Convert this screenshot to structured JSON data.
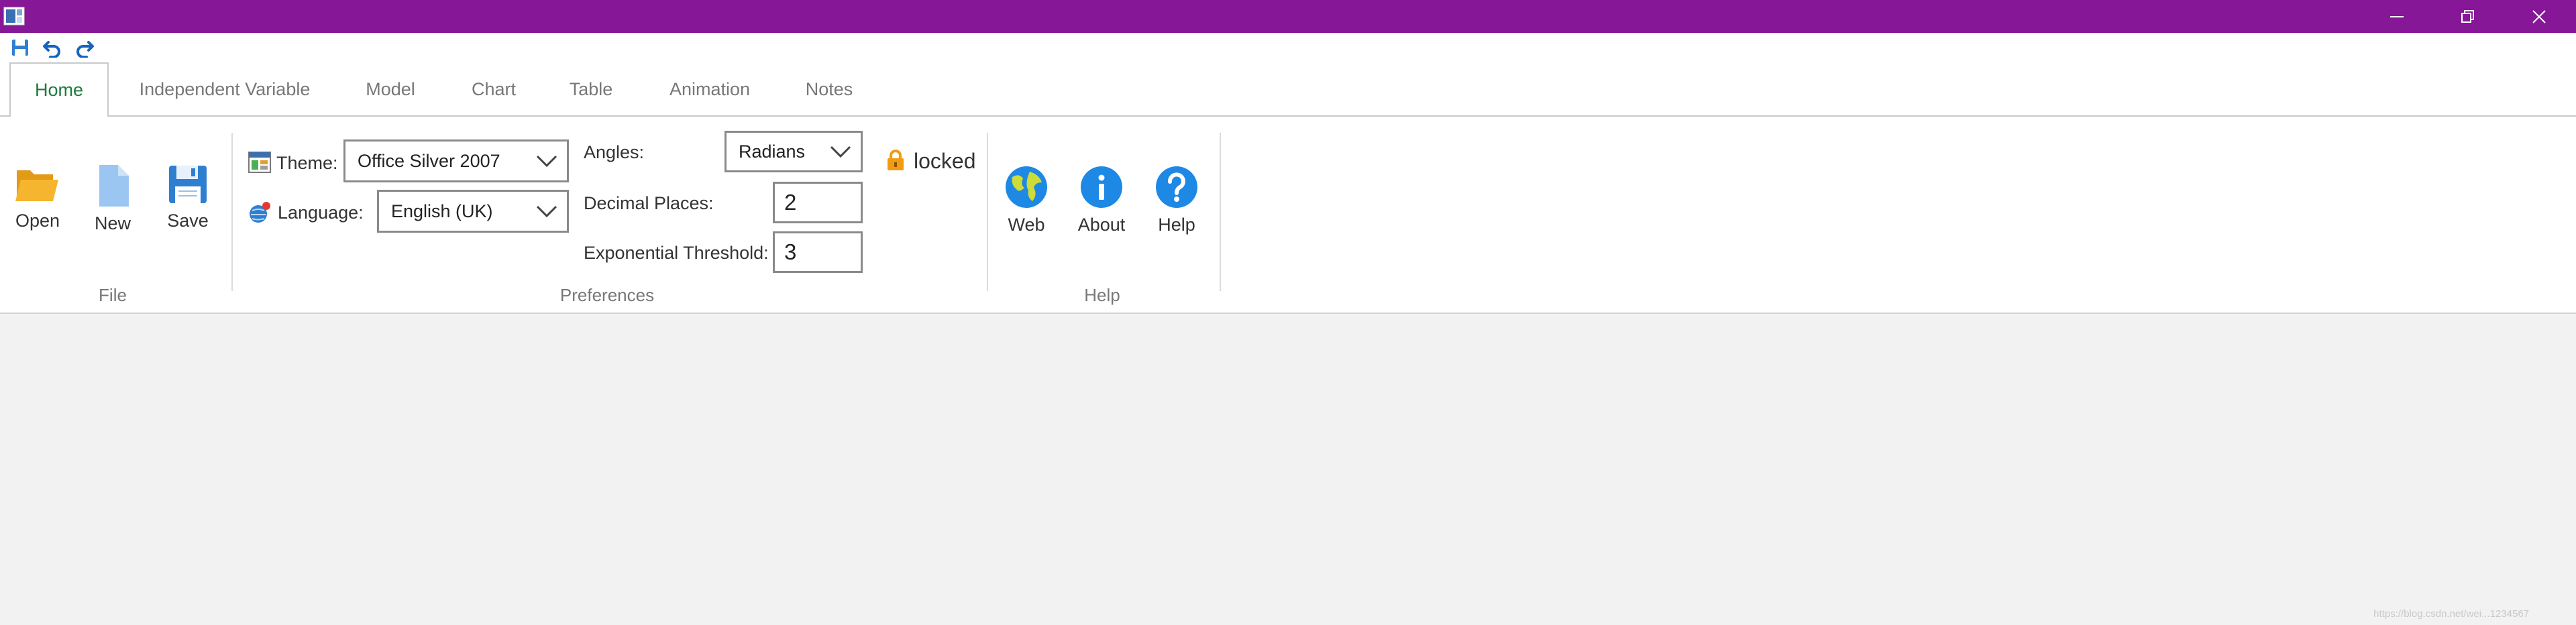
{
  "window": {
    "minimize_glyph": "—",
    "restore_glyph": "❐",
    "close_glyph": "✕"
  },
  "quick_access": {
    "icons": [
      "save-icon",
      "undo-icon",
      "redo-icon"
    ]
  },
  "tabs": [
    {
      "label": "Home",
      "active": true
    },
    {
      "label": "Independent Variable",
      "active": false
    },
    {
      "label": "Model",
      "active": false
    },
    {
      "label": "Chart",
      "active": false
    },
    {
      "label": "Table",
      "active": false
    },
    {
      "label": "Animation",
      "active": false
    },
    {
      "label": "Notes",
      "active": false
    }
  ],
  "ribbon": {
    "file": {
      "group_label": "File",
      "open_label": "Open",
      "new_label": "New",
      "save_label": "Save"
    },
    "preferences": {
      "group_label": "Preferences",
      "theme_label": "Theme:",
      "theme_value": "Office Silver 2007",
      "language_label": "Language:",
      "language_value": "English (UK)",
      "angles_label": "Angles:",
      "angles_value": "Radians",
      "decimal_places_label": "Decimal Places:",
      "decimal_places_value": "2",
      "exp_threshold_label": "Exponential Threshold:",
      "exp_threshold_value": "3",
      "lock_label": "locked"
    },
    "help": {
      "group_label": "Help",
      "web_label": "Web",
      "about_label": "About",
      "help_label": "Help"
    }
  },
  "colors": {
    "titlebar": "#861797",
    "active_tab_text": "#1b7a3e",
    "folder": "#f5b52e",
    "save_blue": "#2f7fd0",
    "help_blue": "#1e88e5",
    "lock_orange": "#f39c12"
  },
  "watermark": "https://blog.csdn.net/wei...1234567"
}
